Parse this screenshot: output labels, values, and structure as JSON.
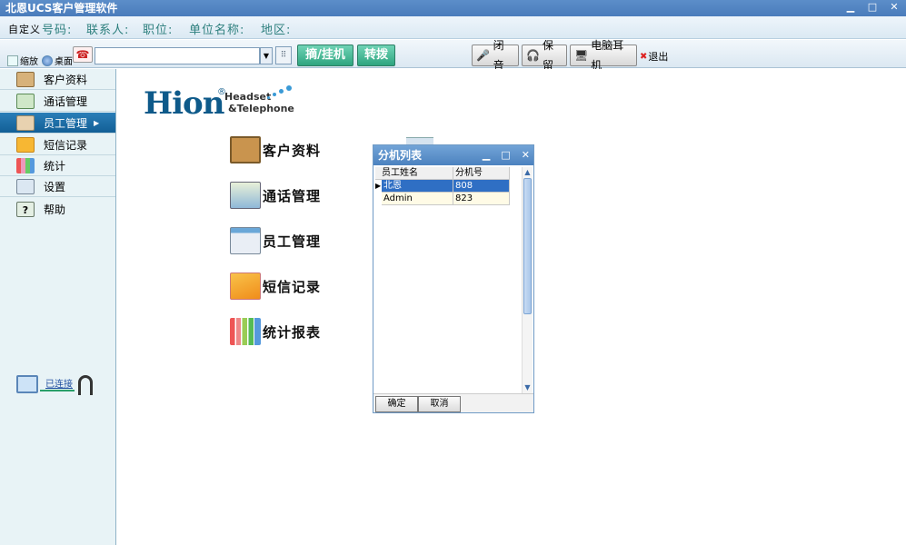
{
  "window": {
    "title": "北恩UCS客户管理软件",
    "minimize": "▁",
    "maximize": "□",
    "close": "✕"
  },
  "info_bar": {
    "custom": "自定义",
    "number_label": "号码:",
    "contact_label": "联系人:",
    "position_label": "职位:",
    "company_label": "单位名称:",
    "region_label": "地区:"
  },
  "toolbar": {
    "shrink_label": "缩放",
    "desktop_label": "桌面",
    "dial_value": "",
    "pickup_hangup": "摘/挂机",
    "transfer": "转拨",
    "mute": "闭音",
    "hold": "保留",
    "pc_headset": "电脑耳机",
    "exit": "退出"
  },
  "sidebar": {
    "items": [
      {
        "label": "客户资料",
        "icon": "customer-card-icon"
      },
      {
        "label": "通话管理",
        "icon": "call-management-icon"
      },
      {
        "label": "员工管理",
        "icon": "staff-icon",
        "active": true
      },
      {
        "label": "短信记录",
        "icon": "envelope-icon"
      },
      {
        "label": "统计",
        "icon": "bar-chart-icon"
      },
      {
        "label": "设置",
        "icon": "settings-icon"
      },
      {
        "label": "帮助",
        "icon": "help-icon"
      }
    ],
    "status": "已连接"
  },
  "main": {
    "logo_big": "Hion",
    "logo_sup": "®",
    "logo_line1": "Headset",
    "logo_line2": "&Telephone",
    "links": [
      {
        "label": "客户资料"
      },
      {
        "label": "通话管理"
      },
      {
        "label": "员工管理"
      },
      {
        "label": "短信记录"
      },
      {
        "label": "统计报表"
      }
    ]
  },
  "dialog": {
    "title": "分机列表",
    "columns": [
      "员工姓名",
      "分机号"
    ],
    "rows": [
      {
        "name": "北恩",
        "ext": "808"
      },
      {
        "name": "Admin",
        "ext": "823"
      }
    ],
    "ok": "确定",
    "cancel": "取消"
  },
  "colors": {
    "title_bar": "#4a7cbb",
    "sidebar_active": "#125f96",
    "accent_green": "#2ea57f",
    "info_text": "#2d7f7d"
  }
}
